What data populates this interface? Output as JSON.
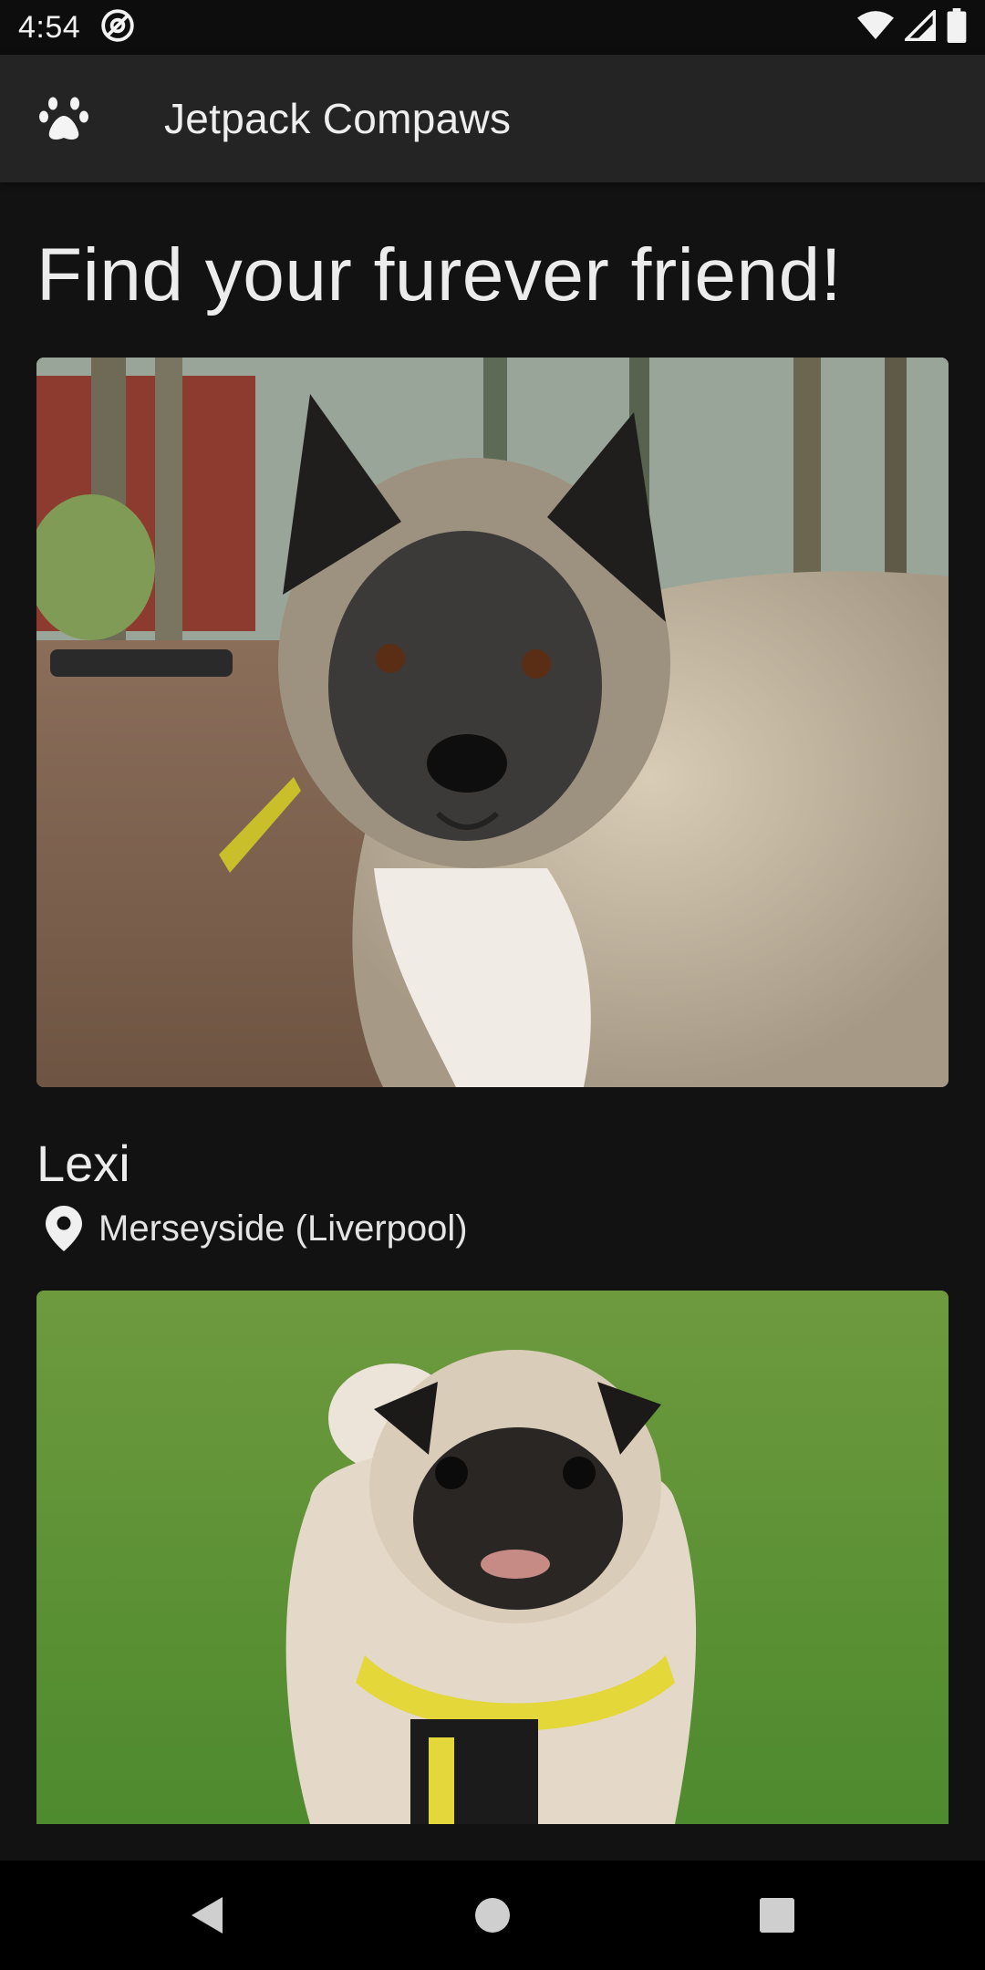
{
  "status_bar": {
    "time": "4:54",
    "icons": [
      "at-sign-icon",
      "wifi-icon",
      "cell-signal-icon",
      "battery-icon"
    ]
  },
  "app_bar": {
    "icon": "paw-icon",
    "title": "Jetpack Compaws"
  },
  "main": {
    "headline": "Find your furever friend!",
    "pets": [
      {
        "name": "Lexi",
        "location": "Merseyside (Liverpool)",
        "photo": "akita-dog-photo"
      },
      {
        "name": "",
        "location": "",
        "photo": "pug-dog-photo"
      }
    ]
  },
  "nav_bar": {
    "buttons": [
      "back-icon",
      "home-icon",
      "recents-icon"
    ]
  },
  "colors": {
    "background": "#121212",
    "app_bar": "#242424",
    "text": "#ececec"
  }
}
